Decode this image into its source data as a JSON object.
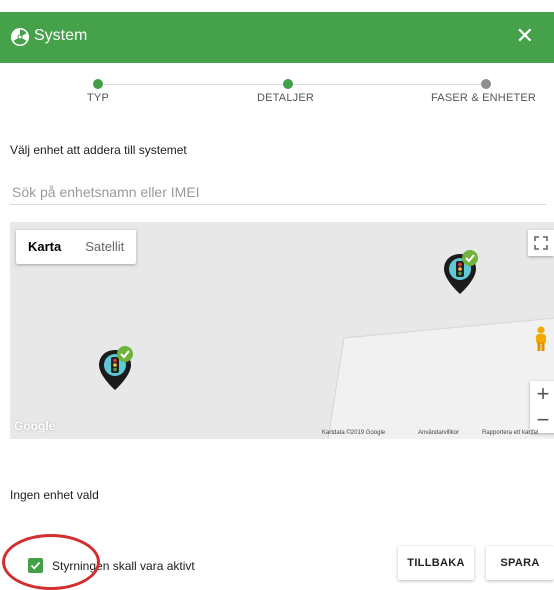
{
  "dialog": {
    "title": "System",
    "close_glyph": "✕",
    "header_color": "#45a14a"
  },
  "stepper": {
    "steps": [
      {
        "label": "TYP",
        "state": "done",
        "color": "#43a047"
      },
      {
        "label": "DETALJER",
        "state": "active",
        "color": "#43a047"
      },
      {
        "label": "FASER & ENHETER",
        "state": "pending",
        "color": "#8e8e8e"
      }
    ]
  },
  "main": {
    "instruction": "Välj enhet att addera till systemet",
    "search_placeholder": "Sök på enhetsnamn eller IMEI"
  },
  "map": {
    "type_buttons": {
      "map": "Karta",
      "satellite": "Satellit"
    },
    "selected_type": "Karta",
    "google_logo": "Google",
    "attribution": {
      "data": "Kartdata ©2019 Google",
      "terms": "Användarvillkor",
      "report": "Rapportera ett kartfel"
    },
    "zoom_in": "+",
    "zoom_out": "−",
    "markers": [
      "traffic-light-marker",
      "traffic-light-marker"
    ]
  },
  "footer": {
    "status": "Ingen enhet vald",
    "checkbox_label": "Styrningen skall vara aktivt",
    "checkbox_checked": true,
    "back_button": "TILLBAKA",
    "save_button": "SPARA"
  }
}
